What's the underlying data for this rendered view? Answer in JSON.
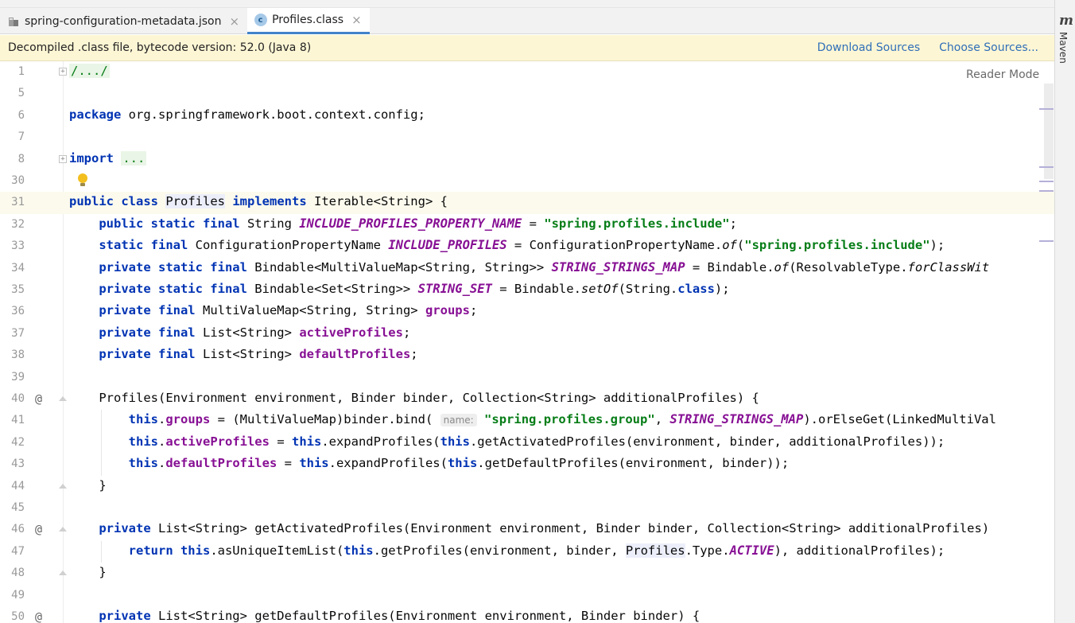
{
  "tabs": [
    {
      "label": "spring-configuration-metadata.json",
      "close": "×",
      "active": false,
      "icon": "json-file-icon"
    },
    {
      "label": "Profiles.class",
      "close": "×",
      "active": true,
      "icon": "class-c-icon",
      "icon_letter": "c"
    }
  ],
  "banner": {
    "message": "Decompiled .class file, bytecode version: 52.0 (Java 8)",
    "download_sources": "Download Sources",
    "choose_sources": "Choose Sources..."
  },
  "editor": {
    "reader_mode": "Reader Mode",
    "lines": [
      {
        "n": "1"
      },
      {
        "n": "5"
      },
      {
        "n": "6"
      },
      {
        "n": "7"
      },
      {
        "n": "8"
      },
      {
        "n": "30"
      },
      {
        "n": "31"
      },
      {
        "n": "32"
      },
      {
        "n": "33"
      },
      {
        "n": "34"
      },
      {
        "n": "35"
      },
      {
        "n": "36"
      },
      {
        "n": "37"
      },
      {
        "n": "38"
      },
      {
        "n": "39"
      },
      {
        "n": "40"
      },
      {
        "n": "41"
      },
      {
        "n": "42"
      },
      {
        "n": "43"
      },
      {
        "n": "44"
      },
      {
        "n": "45"
      },
      {
        "n": "46"
      },
      {
        "n": "47"
      },
      {
        "n": "48"
      },
      {
        "n": "49"
      },
      {
        "n": "50"
      }
    ],
    "gutter_marks": {
      "40": "@",
      "46": "@",
      "50": "@"
    },
    "code": {
      "l1": "/.../",
      "l6": {
        "kw": "package",
        "rest": " org.springframework.boot.context.config;"
      },
      "l8": {
        "kw": "import",
        "fold": "..."
      },
      "l31": {
        "kw1": "public class",
        "name": "Profiles",
        "kw2": "implements",
        "rest": " Iterable<String> {"
      },
      "l32": {
        "kw": "public static final",
        "type": " String ",
        "const": "INCLUDE_PROFILES_PROPERTY_NAME",
        "eq": " = ",
        "str": "\"spring.profiles.include\"",
        "end": ";"
      },
      "l33": {
        "kw": "static final",
        "type": " ConfigurationPropertyName ",
        "const": "INCLUDE_PROFILES",
        "eq": " = ConfigurationPropertyName.",
        "m": "of",
        "open": "(",
        "str": "\"spring.profiles.include\"",
        "end": ");"
      },
      "l34": {
        "kw": "private static final",
        "type": " Bindable<MultiValueMap<String, String>> ",
        "const": "STRING_STRINGS_MAP",
        "eq": " = Bindable.",
        "m": "of",
        "rest": "(ResolvableType.",
        "m2": "forClassWit"
      },
      "l35": {
        "kw": "private static final",
        "type": " Bindable<Set<String>> ",
        "const": "STRING_SET",
        "eq": " = Bindable.",
        "m": "setOf",
        "rest": "(String.",
        "kw2": "class",
        "end": ");"
      },
      "l36": {
        "kw": "private final",
        "type": " MultiValueMap<String, String> ",
        "fld": "groups",
        "end": ";"
      },
      "l37": {
        "kw": "private final",
        "type": " List<String> ",
        "fld": "activeProfiles",
        "end": ";"
      },
      "l38": {
        "kw": "private final",
        "type": " List<String> ",
        "fld": "defaultProfiles",
        "end": ";"
      },
      "l40": "Profiles(Environment environment, Binder binder, Collection<String> additionalProfiles) {",
      "l41": {
        "kw": "this",
        "fld": "groups",
        "mid": " = (MultiValueMap)binder.bind( ",
        "hint": "name:",
        "str": "\"spring.profiles.group\"",
        "sep": ", ",
        "const": "STRING_STRINGS_MAP",
        "rest": ").orElseGet(LinkedMultiVal"
      },
      "l42": {
        "kw": "this",
        "fld": "activeProfiles",
        "mid": " = ",
        "kw2": "this",
        "m": ".expandProfiles(",
        "kw3": "this",
        "rest": ".getActivatedProfiles(environment, binder, additionalProfiles));"
      },
      "l43": {
        "kw": "this",
        "fld": "defaultProfiles",
        "mid": " = ",
        "kw2": "this",
        "m": ".expandProfiles(",
        "kw3": "this",
        "rest": ".getDefaultProfiles(environment, binder));"
      },
      "l44": "}",
      "l46": {
        "kw": "private",
        "rest": " List<String> getActivatedProfiles(Environment environment, Binder binder, Collection<String> additionalProfiles)"
      },
      "l47": {
        "kw": "return this",
        "m": ".asUniqueItemList(",
        "kw2": "this",
        "m2": ".getProfiles(environment, binder, ",
        "hl": "Profiles",
        "mid": ".Type.",
        "const": "ACTIVE",
        "rest": "), additionalProfiles);"
      },
      "l48": "}",
      "l50": {
        "kw": "private",
        "rest": " List<String> getDefaultProfiles(Environment environment, Binder binder) {"
      }
    }
  },
  "tool_window": {
    "icon_letter": "m",
    "label": "Maven"
  }
}
